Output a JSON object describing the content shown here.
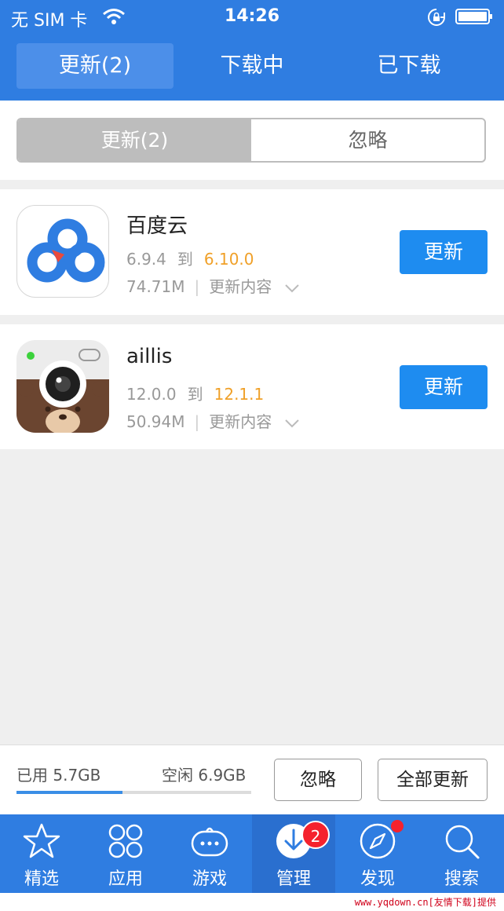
{
  "status_bar": {
    "carrier": "无 SIM 卡",
    "time": "14:26"
  },
  "top_tabs": [
    {
      "label": "更新(2)",
      "active": true
    },
    {
      "label": "下载中",
      "active": false
    },
    {
      "label": "已下载",
      "active": false
    }
  ],
  "segment": {
    "updates_label": "更新(2)",
    "ignore_label": "忽略"
  },
  "apps": [
    {
      "name": "百度云",
      "current_version": "6.9.4",
      "to_label": "到",
      "new_version": "6.10.0",
      "size": "74.71M",
      "changelog_label": "更新内容",
      "update_label": "更新",
      "icon": "baidu-cloud-icon"
    },
    {
      "name": "aillis",
      "current_version": "12.0.0",
      "to_label": "到",
      "new_version": "12.1.1",
      "size": "50.94M",
      "changelog_label": "更新内容",
      "update_label": "更新",
      "icon": "aillis-camera-icon"
    }
  ],
  "storage": {
    "used_label": "已用 5.7GB",
    "free_label": "空闲 6.9GB",
    "used_fraction": 0.45,
    "ignore_button": "忽略",
    "update_all_button": "全部更新"
  },
  "tabbar": {
    "items": [
      {
        "label": "精选",
        "icon": "star-icon"
      },
      {
        "label": "应用",
        "icon": "apps-grid-icon"
      },
      {
        "label": "游戏",
        "icon": "game-controller-icon"
      },
      {
        "label": "管理",
        "icon": "download-manage-icon",
        "active": true,
        "badge": "2"
      },
      {
        "label": "发现",
        "icon": "compass-icon",
        "dot": true
      },
      {
        "label": "搜索",
        "icon": "search-icon"
      }
    ]
  },
  "watermark": "www.yqdown.cn[友情下载]提供",
  "colors": {
    "primary": "#2f7de1",
    "update_button": "#1e8cf0",
    "new_version": "#f0a028",
    "badge": "#f5222d"
  }
}
